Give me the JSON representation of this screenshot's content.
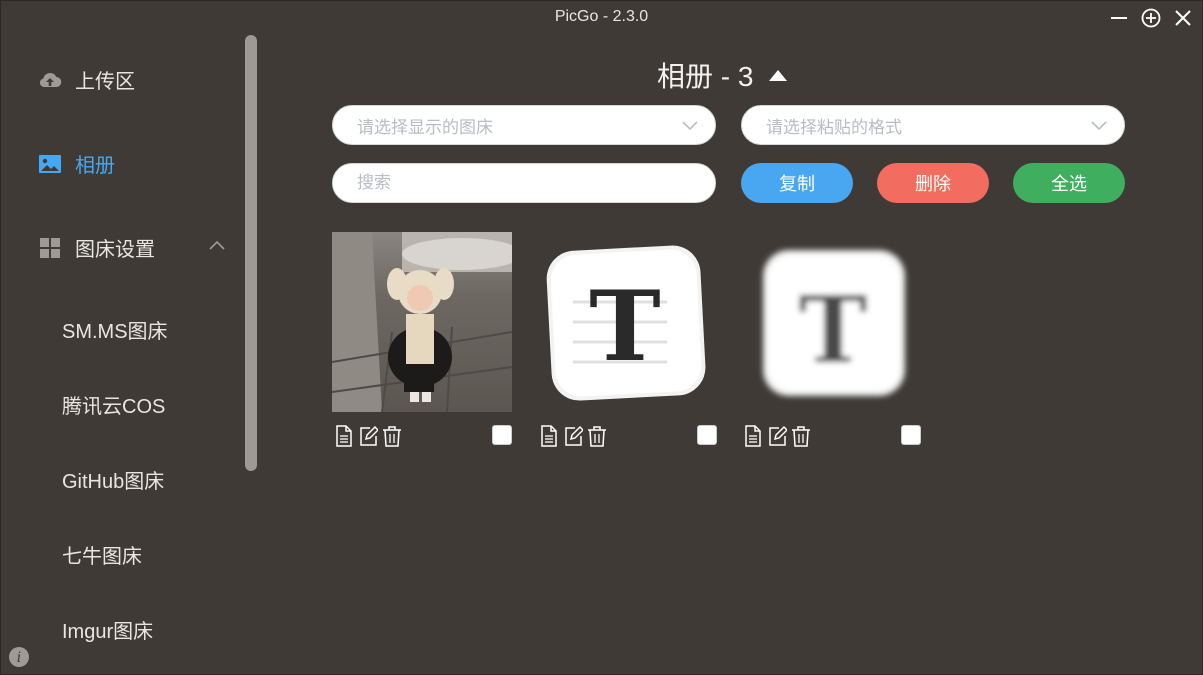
{
  "window": {
    "title": "PicGo - 2.3.0"
  },
  "sidebar": {
    "items": [
      {
        "label": "上传区",
        "icon": "cloud-upload-icon"
      },
      {
        "label": "相册",
        "icon": "image-icon"
      },
      {
        "label": "图床设置",
        "icon": "grid-icon"
      }
    ],
    "sub_items": [
      {
        "label": "SM.MS图床"
      },
      {
        "label": "腾讯云COS"
      },
      {
        "label": "GitHub图床"
      },
      {
        "label": "七牛图床"
      },
      {
        "label": "Imgur图床"
      }
    ]
  },
  "main": {
    "heading": "相册 - 3",
    "picbed_select": {
      "placeholder": "请选择显示的图床"
    },
    "format_select": {
      "placeholder": "请选择粘贴的格式"
    },
    "search": {
      "placeholder": "搜索"
    },
    "buttons": {
      "copy": "复制",
      "delete": "删除",
      "select_all": "全选"
    }
  },
  "colors": {
    "accent": "#44a8f2",
    "copy_button": "#49a7f1",
    "delete_button": "#f26d5f",
    "select_all_button": "#3fae5e",
    "background": "#3f3a36"
  }
}
